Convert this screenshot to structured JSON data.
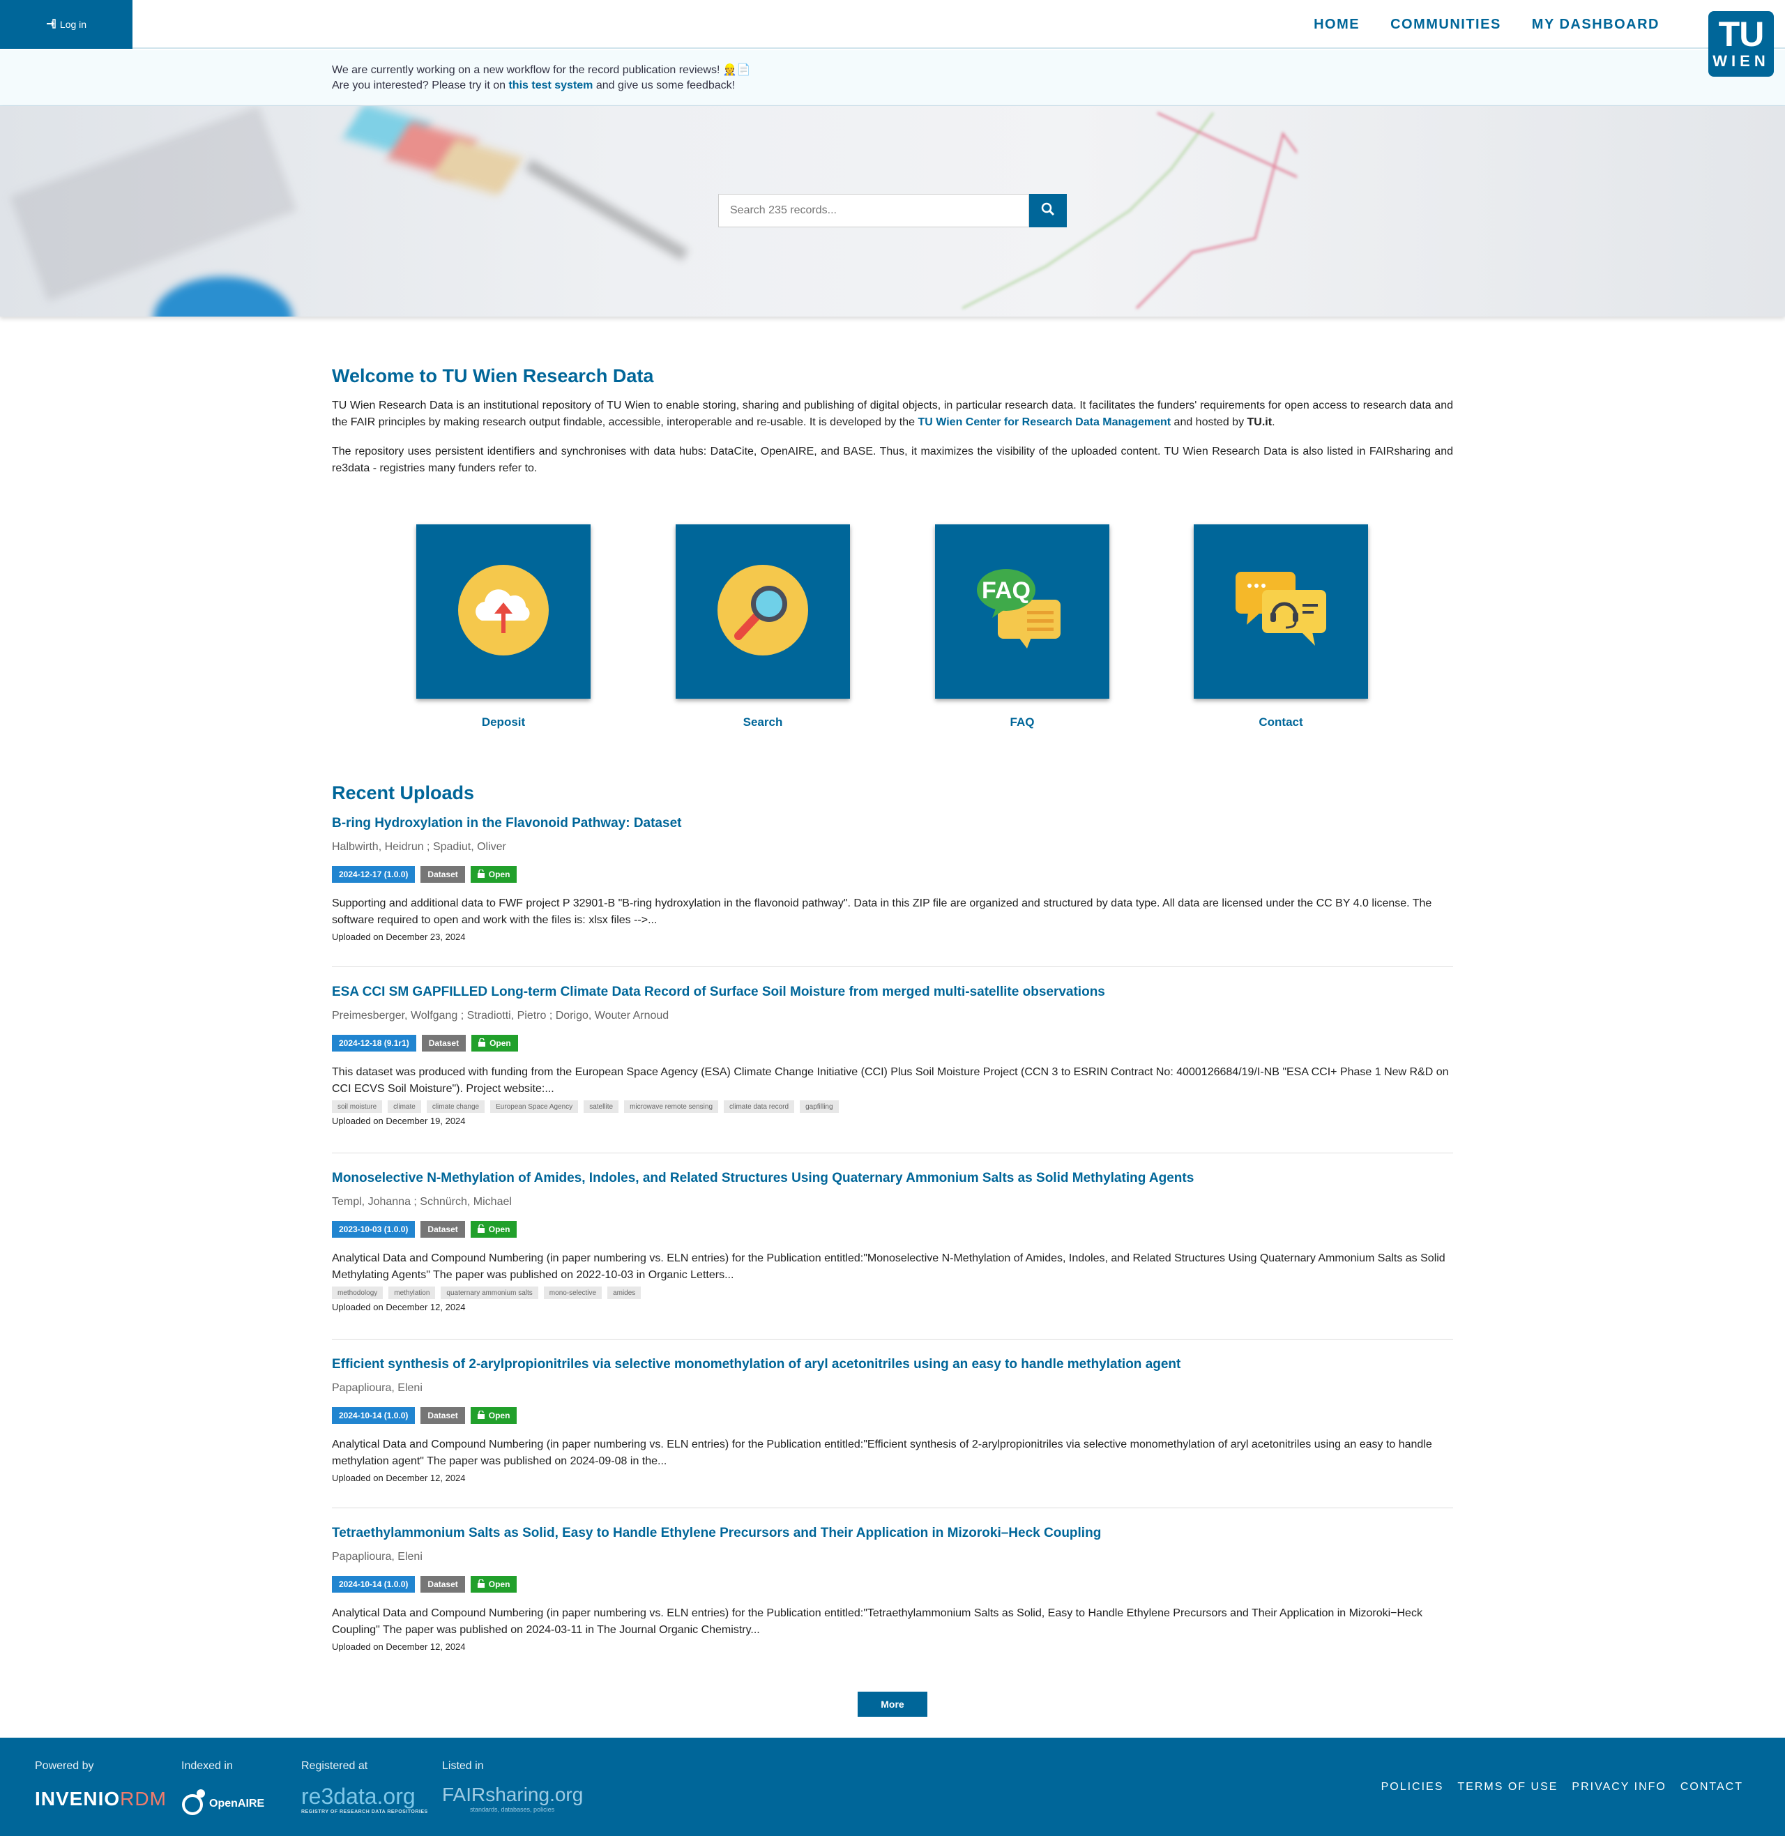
{
  "header": {
    "login_label": "Log in",
    "nav": [
      "HOME",
      "COMMUNITIES",
      "MY DASHBOARD"
    ],
    "logo_top": "TU",
    "logo_bottom": "WIEN"
  },
  "announcement": {
    "line1": "We are currently working on a new workflow for the record publication reviews! 👷📄",
    "line2_before": "Are you interested? Please try it on ",
    "line2_link": "this test system",
    "line2_after": " and give us some feedback!"
  },
  "search": {
    "placeholder": "Search 235 records..."
  },
  "welcome": {
    "title": "Welcome to TU Wien Research Data",
    "p1_a": "TU Wien Research Data is an institutional repository of TU Wien to enable storing, sharing and publishing of digital objects, in particular research data. It facilitates the funders' requirements for open access to research data and the FAIR principles by making research output findable, accessible, interoperable and re-usable. It is developed by the ",
    "p1_link": "TU Wien Center for Research Data Management",
    "p1_b": " and hosted by ",
    "p1_host": "TU.it",
    "p1_c": ".",
    "p2": "The repository uses persistent identifiers and synchronises with data hubs: DataCite, OpenAIRE, and BASE. Thus, it maximizes the visibility of the uploaded content. TU Wien Research Data is also listed in FAIRsharing and re3data - registries many funders refer to."
  },
  "tiles": [
    {
      "label": "Deposit",
      "icon": "cloud-upload-icon"
    },
    {
      "label": "Search",
      "icon": "magnifier-icon"
    },
    {
      "label": "FAQ",
      "icon": "faq-icon",
      "icon_text": "FAQ"
    },
    {
      "label": "Contact",
      "icon": "support-chat-icon"
    }
  ],
  "recent": {
    "title": "Recent Uploads",
    "records": [
      {
        "title": "B-ring Hydroxylation in the Flavonoid Pathway: Dataset",
        "authors": "Halbwirth, Heidrun ; Spadiut, Oliver",
        "date": "2024-12-17 (1.0.0)",
        "type": "Dataset",
        "access": "Open",
        "desc": "Supporting and additional data to FWF project P 32901-B \"B-ring hydroxylation in the flavonoid pathway\". Data in this ZIP file are organized and structured by data type. All data are licensed under the CC BY 4.0 license. The software required to open and work with the files is: xlsx files -->...",
        "keywords": [],
        "uploaded": "Uploaded on December 23, 2024"
      },
      {
        "title": "ESA CCI SM GAPFILLED Long-term Climate Data Record of Surface Soil Moisture from merged multi-satellite observations",
        "authors": "Preimesberger, Wolfgang ; Stradiotti, Pietro ; Dorigo, Wouter Arnoud",
        "date": "2024-12-18 (9.1r1)",
        "type": "Dataset",
        "access": "Open",
        "desc": "This dataset was produced with funding from the European Space Agency (ESA) Climate Change Initiative (CCI) Plus Soil Moisture Project (CCN 3 to ESRIN Contract No: 4000126684/19/I-NB \"ESA CCI+ Phase 1 New R&D on CCI ECVS Soil Moisture\").  Project website:...",
        "keywords": [
          "soil moisture",
          "climate",
          "climate change",
          "European Space Agency",
          "satellite",
          "microwave remote sensing",
          "climate data record",
          "gapfilling"
        ],
        "uploaded": "Uploaded on December 19, 2024"
      },
      {
        "title": "Monoselective N-Methylation of Amides, Indoles, and Related Structures Using Quaternary Ammonium Salts as Solid Methylating Agents",
        "authors": "Templ, Johanna ; Schnürch, Michael",
        "date": "2023-10-03 (1.0.0)",
        "type": "Dataset",
        "access": "Open",
        "desc": "Analytical Data and Compound Numbering (in paper numbering vs. ELN entries) for the Publication entitled:\"Monoselective N-Methylation of Amides, Indoles, and Related Structures Using Quaternary Ammonium Salts as Solid Methylating Agents\" The paper was published on 2022-10-03 in Organic Letters...",
        "keywords": [
          "methodology",
          "methylation",
          "quaternary ammonium salts",
          "mono-selective",
          "amides"
        ],
        "uploaded": "Uploaded on December 12, 2024"
      },
      {
        "title": "Efficient synthesis of 2-arylpropionitriles via selective monomethylation of aryl acetonitriles using an easy to handle methylation agent",
        "authors": "Papaplioura, Eleni",
        "date": "2024-10-14 (1.0.0)",
        "type": "Dataset",
        "access": "Open",
        "desc": "Analytical Data and Compound Numbering (in paper numbering vs. ELN entries) for the Publication entitled:\"Efficient synthesis of 2-arylpropionitriles via selective monomethylation of aryl acetonitriles using an easy to handle methylation agent\" The paper was published on 2024-09-08 in the...",
        "keywords": [],
        "uploaded": "Uploaded on December 12, 2024"
      },
      {
        "title": "Tetraethylammonium Salts as Solid, Easy to Handle Ethylene Precursors and Their Application in Mizoroki–Heck Coupling",
        "authors": "Papaplioura, Eleni",
        "date": "2024-10-14 (1.0.0)",
        "type": "Dataset",
        "access": "Open",
        "desc": "Analytical Data and Compound Numbering (in paper numbering vs. ELN entries) for the Publication entitled:\"Tetraethylammonium Salts as Solid, Easy to Handle Ethylene Precursors and Their Application in Mizoroki−Heck Coupling\" The paper was published on 2024-03-11 in The Journal Organic Chemistry...",
        "keywords": [],
        "uploaded": "Uploaded on December 12, 2024"
      }
    ],
    "more_label": "More"
  },
  "footer": {
    "powered_by": "Powered by",
    "indexed_in": "Indexed in",
    "registered_at": "Registered at",
    "listed_in": "Listed in",
    "invenio_a": "INVENIO",
    "invenio_b": "RDM",
    "openaire": "OpenAIRE",
    "re3data": "re3data.org",
    "re3data_sub": "REGISTRY OF RESEARCH DATA REPOSITORIES",
    "fairsharing": "FAIRsharing.org",
    "fairsharing_sub": "standards, databases, policies",
    "links": [
      "POLICIES",
      "TERMS OF USE",
      "PRIVACY INFO",
      "CONTACT"
    ]
  },
  "colors": {
    "brand": "#006699",
    "date_badge": "#2185d0",
    "type_badge": "#767676",
    "open_badge": "#21a02b"
  }
}
